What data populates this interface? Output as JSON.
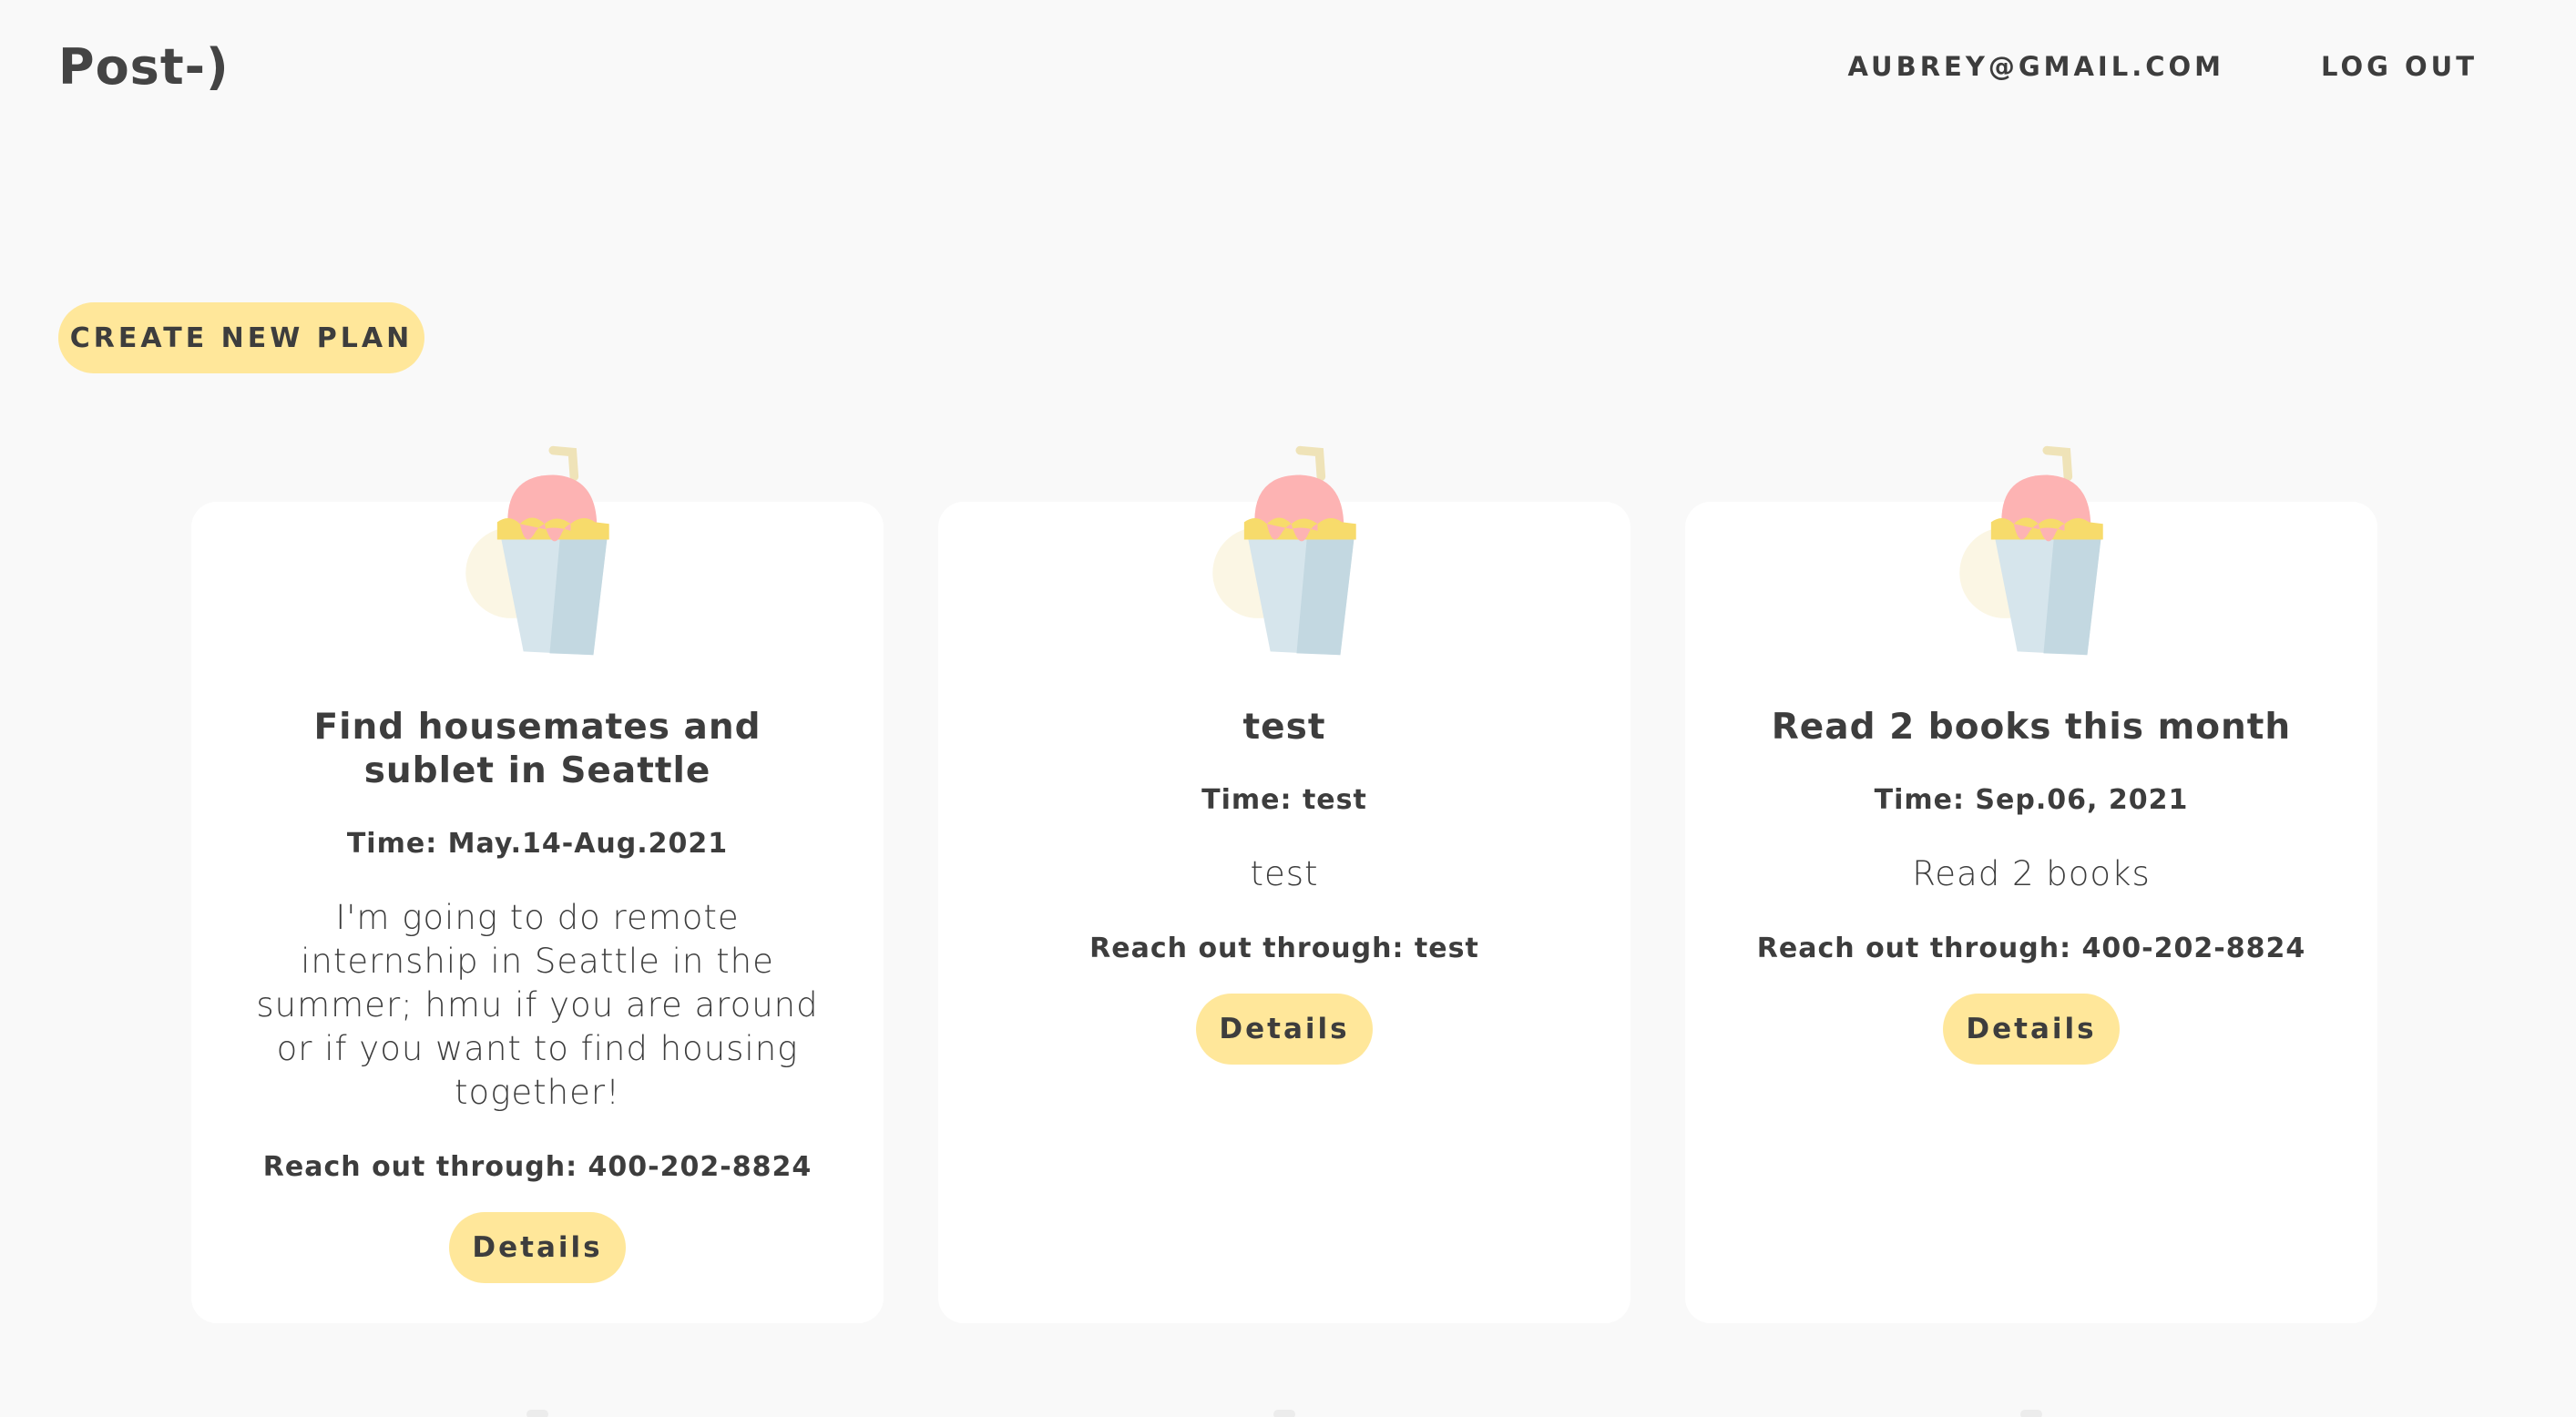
{
  "header": {
    "logo": "Post-)",
    "email": "AUBREY@GMAIL.COM",
    "logout": "LOG OUT"
  },
  "actions": {
    "create_plan": "CREATE NEW PLAN"
  },
  "colors": {
    "accent": "#ffe79a",
    "background": "#f9f9f9",
    "card": "#ffffff",
    "text": "#3d3d3d"
  },
  "plans": [
    {
      "title": "Find housemates and sublet in Seattle",
      "time": "Time: May.14-Aug.2021",
      "description": "I'm going to do remote internship in Seattle in the summer; hmu if you are around or if you want to find housing together!",
      "contact": "Reach out through: 400-202-8824",
      "details_label": "Details",
      "icon": "ice-cream-cup-icon"
    },
    {
      "title": "test",
      "time": "Time: test",
      "description": "test",
      "contact": "Reach out through: test",
      "details_label": "Details",
      "icon": "ice-cream-cup-icon"
    },
    {
      "title": "Read 2 books this month",
      "time": "Time: Sep.06, 2021",
      "description": "Read 2 books",
      "contact": "Reach out through: 400-202-8824",
      "details_label": "Details",
      "icon": "ice-cream-cup-icon"
    }
  ]
}
